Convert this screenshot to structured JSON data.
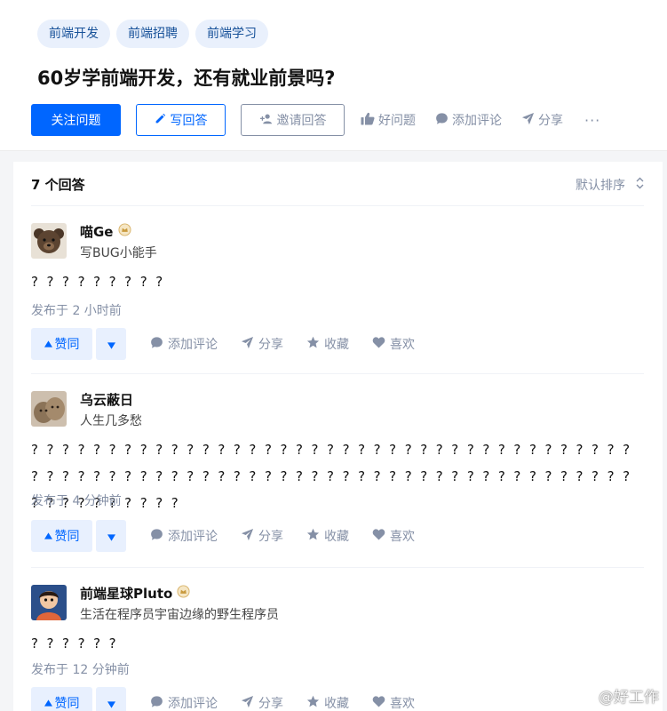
{
  "question": {
    "topics": [
      "前端开发",
      "前端招聘",
      "前端学习"
    ],
    "title": "60岁学前端开发，还有就业前景吗?",
    "actions": {
      "follow": "关注问题",
      "write": "写回答",
      "invite": "邀请回答",
      "good": "好问题",
      "comment": "添加评论",
      "share": "分享",
      "more": "···"
    }
  },
  "answers_header": {
    "count": "7 个回答",
    "sort": "默认排序"
  },
  "answers": [
    {
      "name": "喵Ge",
      "bio": "写BUG小能手",
      "content": "? ? ? ? ? ? ? ? ?",
      "time": "发布于 2 小时前",
      "has_badge": true
    },
    {
      "name": "乌云蔽日",
      "bio": "人生几多愁",
      "content": "? ? ? ? ? ? ? ? ? ? ? ? ? ? ? ? ? ? ? ? ? ? ? ? ? ? ? ? ? ? ? ? ? ? ? ? ? ? ? ? ? ? ? ? ? ? ? ? ? ? ? ? ? ? ? ? ? ? ? ? ? ? ? ? ? ? ? ? ? ? ? ? ? ? ? ? ? ? ? ? ? ? ? ? ? ? ? ?",
      "time": "发布于 4 分钟前",
      "has_badge": false
    },
    {
      "name": "前端星球Pluto",
      "bio": "生活在程序员宇宙边缘的野生程序员",
      "content": "? ? ? ? ? ?",
      "time": "发布于 12 分钟前",
      "has_badge": true
    }
  ],
  "answer_actions": {
    "upvote": "赞同",
    "comment": "添加评论",
    "share": "分享",
    "collect": "收藏",
    "like": "喜欢"
  },
  "watermark": "@好工作",
  "colors": {
    "primary": "#0066ff",
    "muted": "#8590a6",
    "topic_bg": "#e9f0fc",
    "vote_bg": "#e8f0fe"
  }
}
